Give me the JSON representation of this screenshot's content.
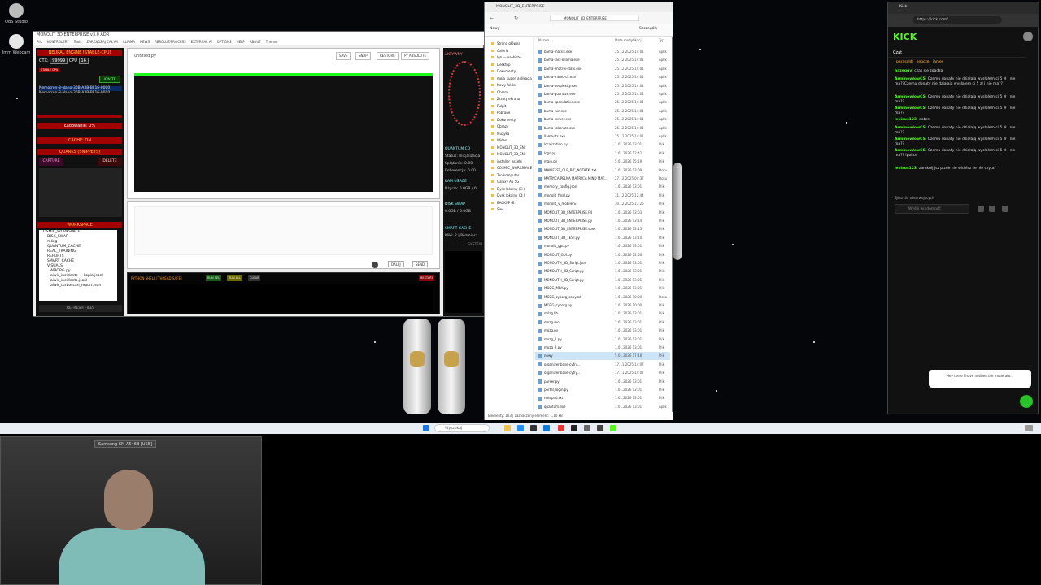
{
  "desktop": {
    "icons": [
      {
        "label": "OBS Studio"
      },
      {
        "label": "Imm Webcam"
      }
    ]
  },
  "app": {
    "title": "MONOLIT 3D ENTERPRISE v3.0 ADR",
    "menu": [
      "Plik",
      "KONTROLERY",
      "Tools",
      "ZARZĄDZAJ CAŁYM",
      "CLIAMA",
      "NEWS",
      "ABSOLUT/PROCESS",
      "EXTERNAL AI",
      "OPTIONS",
      "HELP",
      "ABOUT",
      "Theme"
    ],
    "neural_engine": {
      "header": "NEURAL ENGINE [STABLE-CPU]",
      "ctx_label": "CTX:",
      "ctx_value": "99999",
      "cpu_label": "CPU",
      "cpu_value": "16",
      "stable_badge": "STABLE CPU",
      "ignite_button": "IGNITE",
      "models": [
        "Nemotron-3-Nano-30B-A3B-BF16-0000",
        "Nemotron-3-Nano-30B-A3B-BF16-0000"
      ]
    },
    "loading": "Ładowanie: 0%",
    "cache": "CACHE: ON",
    "quarks": {
      "header": "QUARKS (SNIPPETS)",
      "capture": "CAPTURE",
      "delete": "DELETE"
    },
    "workspace": {
      "header": "WORKSPACE",
      "tree": [
        "COSMIC_WORKSPACE",
        "DISK_SWAP",
        "mózg",
        "QUANTUM_CACHE",
        "REAL_TRAINING",
        "REPORTS",
        "SMART_CACHE",
        "VISUALS",
        "AIBORG.py",
        "aiwir_incidents — kopia.jsonl",
        "aiwir_incidents.jsonl",
        "aiwir_turboscan_report.json"
      ],
      "refresh": "REFRESH FILES"
    },
    "editor": {
      "filename": "untitled.py",
      "save": "SAVE",
      "snap": "SNAP",
      "restore": "RESTORE",
      "py_absolute": "PY ABSOLUTE"
    },
    "output": {
      "dalej": "DALEJ",
      "send": "SEND"
    },
    "shell": {
      "header": "PYTHON SHELL [THREAD SAFE]",
      "run_sel": "RUN SEL",
      "run_all": "RUN ALL",
      "clear": "CLEAR",
      "restart": "RESTART"
    },
    "right": {
      "aktywny": "AKTYWNY",
      "quantum_header": "QUANTUM CO",
      "status": "Status: Inicjalizacja",
      "splatanie": "Splątanie: 0.00",
      "koherencja": "Koherencja: 0.00",
      "ram_header": "RAM USAGE",
      "ram_val": "Użycie: 0.0GB / 0",
      "disk_header": "DISK SWAP",
      "disk_val": "0.0GB / 0.0GB",
      "smart_header": "SMART CACHE",
      "smart_val": "Pliki: 2 | Rozmiar:",
      "system": "SYSTEM"
    }
  },
  "explorer": {
    "title": "MONOLIT_3D_ENTERPRISE",
    "new_button": "Nowy",
    "details": "Szczegóły",
    "col_name": "Nazwa",
    "col_date": "Data modyfikacji",
    "col_type": "Typ",
    "nav": [
      "Strona główna",
      "Galeria",
      "Ign — osobiste",
      "Desktop",
      "Dokumenty",
      "moja_super_aplikacja",
      "Nowy folder",
      "Obrazy",
      "Zrzuty ekranu",
      "Pulpit",
      "Pobrane",
      "Dokumenty",
      "Obrazy",
      "Muzyka",
      "Wideo",
      "MONOLIT_3D_EN",
      "MONOLIT_3D_EN",
      "installer_assets",
      "COSMIC_WORKSPACE",
      "Ten komputer",
      "Galaxy A5 5G",
      "Dysk lokalny (C:)",
      "Dysk lokalny (D:)",
      "BACKUP (E:)",
      "Sieć"
    ],
    "files": [
      {
        "name": "bama-matrix.exe",
        "date": "25.12.2025 14:01",
        "type": "Aplik"
      },
      {
        "name": "bama-fast-ollama.exe",
        "date": "25.12.2025 14:01",
        "type": "Aplik"
      },
      {
        "name": "bama-imatrix-stats.exe",
        "date": "25.12.2025 14:01",
        "type": "Aplik"
      },
      {
        "name": "bama-mtmd-cli.exe",
        "date": "25.12.2025 14:01",
        "type": "Aplik"
      },
      {
        "name": "bama-perplexity.exe",
        "date": "25.12.2025 14:01",
        "type": "Aplik"
      },
      {
        "name": "bama-quantize.exe",
        "date": "25.12.2025 14:01",
        "type": "Aplik"
      },
      {
        "name": "bama-speculative.exe",
        "date": "25.12.2025 14:01",
        "type": "Aplik"
      },
      {
        "name": "bama-run.exe",
        "date": "25.12.2025 14:01",
        "type": "Aplik"
      },
      {
        "name": "bama-server.exe",
        "date": "25.12.2025 14:01",
        "type": "Aplik"
      },
      {
        "name": "bama-tokenize.exe",
        "date": "25.12.2025 14:01",
        "type": "Aplik"
      },
      {
        "name": "llama-tts.exe",
        "date": "25.12.2025 14:01",
        "type": "Aplik"
      },
      {
        "name": "localization.py",
        "date": "1.01.2026 13:01",
        "type": "Plik"
      },
      {
        "name": "logs.py",
        "date": "1.01.2026 12:42",
        "type": "Plik"
      },
      {
        "name": "main.py",
        "date": "5.01.2026 15:19",
        "type": "Plik"
      },
      {
        "name": "MANIFEST_CLE_BIC_NOTATKI.txt",
        "date": "1.01.2026 13:09",
        "type": "Doku"
      },
      {
        "name": "MATRYCA PELNA MATRYCA MIND MAT...",
        "date": "27.12.2025 04:37",
        "type": "Doku"
      },
      {
        "name": "memory_config.json",
        "date": "1.01.2026 13:01",
        "type": "Plik"
      },
      {
        "name": "monolit_final.py",
        "date": "31.12.2025 12:44",
        "type": "Plik"
      },
      {
        "name": "monolit_v_mobile.ST",
        "date": "30.12.2025 13:25",
        "type": "Plik"
      },
      {
        "name": "MONOLIT_3D_ENTERPRISE.F4",
        "date": "1.01.2026 13:03",
        "type": "Plik"
      },
      {
        "name": "MONOLIT_3D_ENTERPRISE.py",
        "date": "1.01.2026 13:14",
        "type": "Plik"
      },
      {
        "name": "MONOLIT_3D_ENTERPRISE.spec",
        "date": "1.01.2026 13:15",
        "type": "Plik"
      },
      {
        "name": "MONOLIT_3D_TEST.py",
        "date": "1.01.2026 13:10",
        "type": "Plik"
      },
      {
        "name": "monolit_gpu.py",
        "date": "1.01.2026 13:01",
        "type": "Plik"
      },
      {
        "name": "MONOLIT_GUI.py",
        "date": "1.01.2026 12:56",
        "type": "Plik"
      },
      {
        "name": "MONOLITH_3D_Script.json",
        "date": "1.01.2026 13:01",
        "type": "Plik"
      },
      {
        "name": "MONOLITH_3D_Script.py",
        "date": "1.01.2026 13:01",
        "type": "Plik"
      },
      {
        "name": "MONOLITH_3D_Script.py",
        "date": "1.01.2026 13:01",
        "type": "Plik"
      },
      {
        "name": "MOZG_MBA.py",
        "date": "1.01.2026 13:01",
        "type": "Plik"
      },
      {
        "name": "MOZG_cyborg_copy.txt",
        "date": "1.01.2026 10:00",
        "type": "Doku"
      },
      {
        "name": "MOZG_cyborg.py",
        "date": "1.01.2026 10:00",
        "type": "Plik"
      },
      {
        "name": "mózg.lib",
        "date": "1.01.2026 13:01",
        "type": "Plik"
      },
      {
        "name": "mozg.mo",
        "date": "1.01.2026 13:01",
        "type": "Plik"
      },
      {
        "name": "mozg.py",
        "date": "1.01.2026 13:01",
        "type": "Plik"
      },
      {
        "name": "mozg_1.py",
        "date": "1.01.2026 13:01",
        "type": "Plik"
      },
      {
        "name": "mozg_2.py",
        "date": "1.01.2026 13:01",
        "type": "Plik"
      },
      {
        "name": "nowy",
        "date": "5.01.2026 17:18",
        "type": "Plik"
      },
      {
        "name": "organizer-base-cyfry...",
        "date": "17.11.2025 14:07",
        "type": "Plik"
      },
      {
        "name": "organizer-base-cyfry...",
        "date": "17.11.2025 14:07",
        "type": "Plik"
      },
      {
        "name": "parser.py",
        "date": "1.01.2026 13:01",
        "type": "Plik"
      },
      {
        "name": "portal_login.py",
        "date": "1.01.2026 13:01",
        "type": "Plik"
      },
      {
        "name": "notepad.txt",
        "date": "1.01.2026 13:01",
        "type": "Plik"
      },
      {
        "name": "quantum.exe",
        "date": "1.01.2026 13:01",
        "type": "Aplik"
      }
    ],
    "status": "Elementy: 103 | zaznaczony element: 1,10 kB"
  },
  "kick": {
    "tab1": "Kick",
    "url": "https://kick.com/...",
    "logo": "KICK",
    "chat_title": "Czat",
    "top_users": [
      "parasoldi",
      "sepcze",
      "janies"
    ],
    "messages": [
      {
        "user": "hazeggy",
        "text": "czas się zgadza"
      },
      {
        "user": "ArminowlowCS",
        "text": "Czemu donaty nie działają wysłałem ci 5 zł i nie ma??Czemu donaty nie działają wysłałem ci 5 zł i nie ma??"
      },
      {
        "user": "ArminowlowCS",
        "text": "Czemu donaty nie działają wysłałem ci 5 zł i nie ma??"
      },
      {
        "user": "ArminowlowCS",
        "text": "Czemu donaty nie działają wysłałem ci 5 zł i nie ma??"
      },
      {
        "user": "levisus123",
        "text": "dobre"
      },
      {
        "user": "ArminowlowCS",
        "text": "Czemu donaty nie działają wysłałem ci 5 zł i nie ma??"
      },
      {
        "user": "ArminowlowCS",
        "text": "Czemu donaty nie działają wysłałem ci 5 zł i nie ma??"
      },
      {
        "user": "ArminowlowCS",
        "text": "Czemu donaty nie działają wysłałem ci 5 zł i nie ma?? ipolice"
      },
      {
        "user": "levisus123",
        "text": "zamknij jsz pizde nie widzisz że nie czyta?"
      }
    ],
    "followers_only": "Tylko dla obserwujących",
    "input_placeholder": "Wyślij wiadomość",
    "toast": "Hey there I have notified the moderato..."
  },
  "taskbar": {
    "search": "Wyszukaj"
  },
  "webcam": {
    "label": "Samsung SM-A546B [USB]"
  }
}
